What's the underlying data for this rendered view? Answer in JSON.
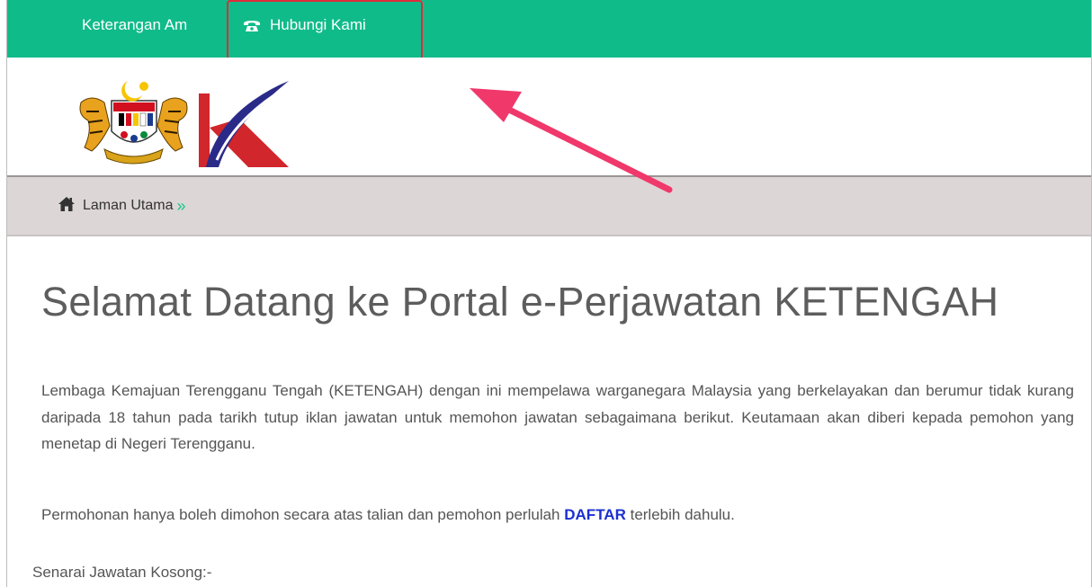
{
  "nav": {
    "items": [
      {
        "label": "Keterangan Am"
      },
      {
        "label": "Hubungi Kami",
        "icon": "phone-icon"
      }
    ]
  },
  "breadcrumb": {
    "home_icon": "home-icon",
    "label": "Laman Utama",
    "separator": "»"
  },
  "content": {
    "title": "Selamat Datang ke Portal e-Perjawatan KETENGAH",
    "intro": "Lembaga Kemajuan Terengganu Tengah (KETENGAH) dengan ini mempelawa warganegara Malaysia yang berkelayakan dan berumur tidak kurang daripada 18 tahun pada tarikh tutup iklan jawatan untuk memohon jawatan sebagaimana berikut. Keutamaan akan diberi kepada pemohon yang menetap di Negeri Terengganu.",
    "apply_prefix": "Permohonan hanya boleh dimohon secara atas talian dan pemohon perlulah ",
    "apply_link": "DAFTAR",
    "apply_suffix": " terlebih dahulu.",
    "vacancies_heading": "Senarai Jawatan Kosong:-"
  },
  "colors": {
    "nav_bg": "#10bb8a",
    "breadcrumb_bg": "#ddd6d6",
    "link": "#1a2fd0",
    "annotation": "#e02b3a",
    "arrow": "#f0386b"
  }
}
